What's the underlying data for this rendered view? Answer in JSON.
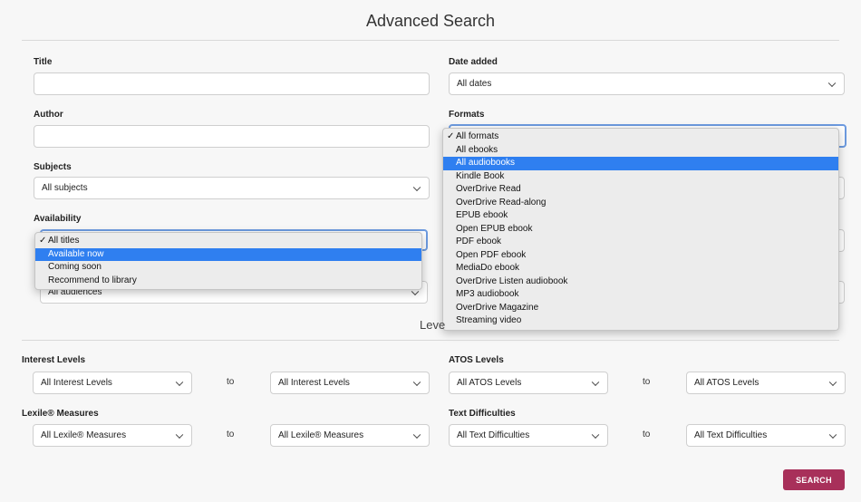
{
  "header": {
    "title": "Advanced Search"
  },
  "fields": {
    "title_label": "Title",
    "title_value": "",
    "author_label": "Author",
    "author_value": "",
    "date_added_label": "Date added",
    "date_added_value": "All dates",
    "formats_label": "Formats",
    "subjects_label": "Subjects",
    "subjects_value": "All subjects",
    "availability_label": "Availability",
    "audience_value": "All audiences"
  },
  "availability_dropdown": {
    "check": "✓",
    "options": [
      "All titles",
      "Available now",
      "Coming soon",
      "Recommend to library"
    ],
    "checked": "All titles",
    "highlighted": "Available now"
  },
  "formats_dropdown": {
    "check": "✓",
    "options": [
      "All formats",
      "All ebooks",
      "All audiobooks",
      "Kindle Book",
      "OverDrive Read",
      "OverDrive Read-along",
      "EPUB ebook",
      "Open EPUB ebook",
      "PDF ebook",
      "Open PDF ebook",
      "MediaDo ebook",
      "OverDrive Listen audiobook",
      "MP3 audiobook",
      "OverDrive Magazine",
      "Streaming video"
    ],
    "checked": "All formats",
    "highlighted": "All audiobooks"
  },
  "levels": {
    "heading_partial": "Leve",
    "to_label": "to",
    "interest_label": "Interest Levels",
    "interest_from": "All Interest Levels",
    "interest_to": "All Interest Levels",
    "atos_label": "ATOS Levels",
    "atos_from": "All ATOS Levels",
    "atos_to": "All ATOS Levels",
    "lexile_label": "Lexile® Measures",
    "lexile_from": "All Lexile® Measures",
    "lexile_to": "All Lexile® Measures",
    "text_diff_label": "Text Difficulties",
    "text_diff_from": "All Text Difficulties",
    "text_diff_to": "All Text Difficulties"
  },
  "actions": {
    "search_label": "SEARCH"
  },
  "colors": {
    "search_button": "#a8305a",
    "highlight": "#2f7ff0",
    "focus_ring": "#6d9be0"
  }
}
